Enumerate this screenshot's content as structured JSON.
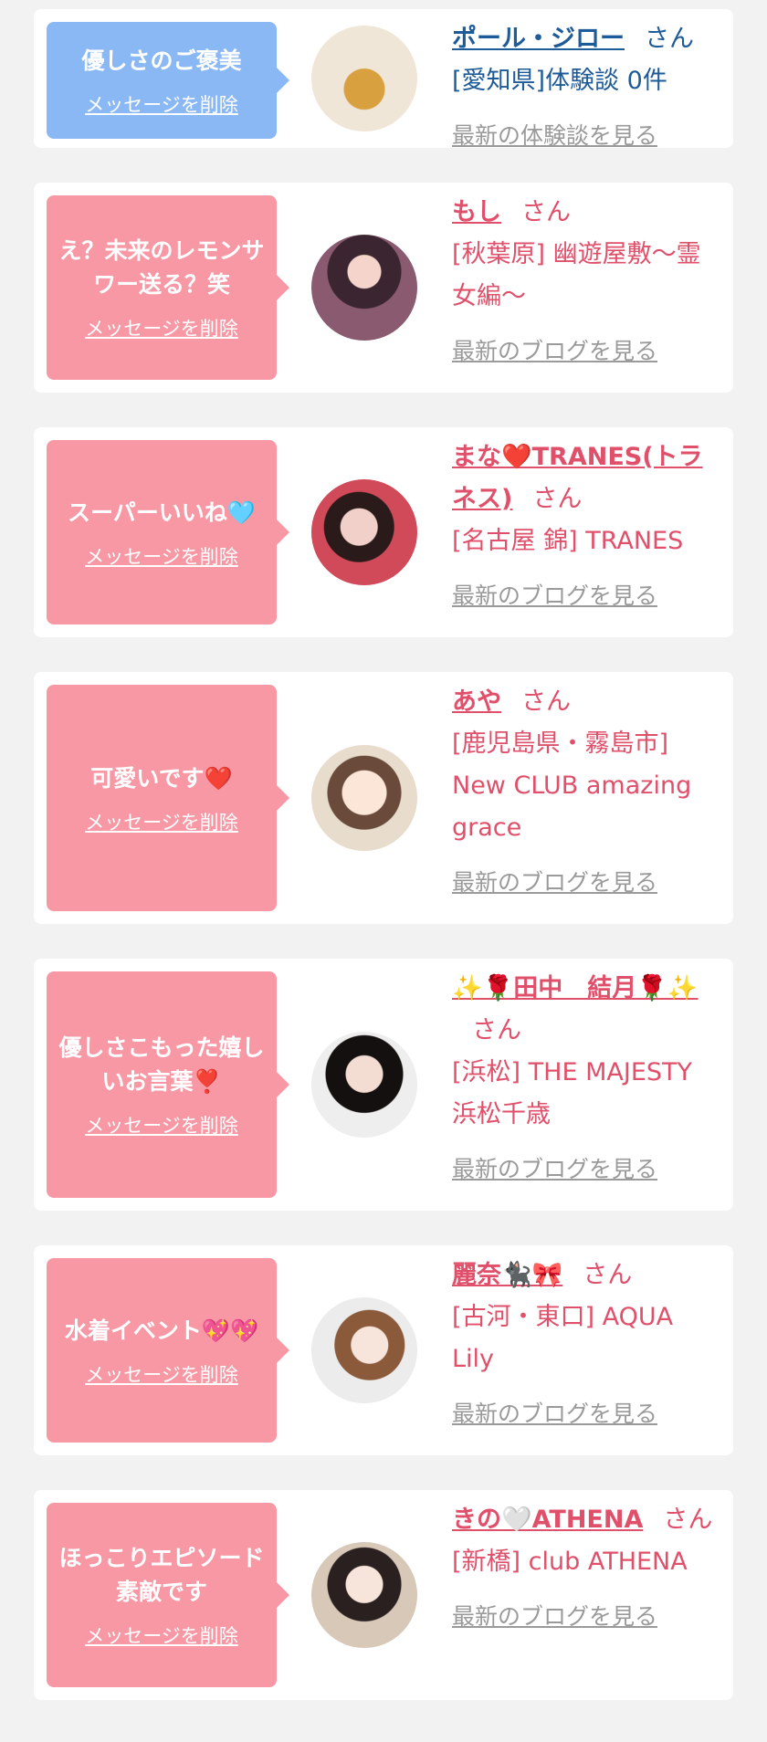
{
  "cards": [
    {
      "message": "優しさのご褒美",
      "delete_label": "メッセージを削除",
      "name": "ポール・ジロー",
      "honorific": "さん",
      "detail": "[愛知県]体験談 0件",
      "latest_label": "最新の体験談を見る",
      "avatar": "bottle-avatar",
      "color": "#8ab8f5"
    },
    {
      "message": "え？未来のレモンサワー送る？笑",
      "delete_label": "メッセージを削除",
      "name": "もし",
      "honorific": "さん",
      "detail": "[秋葉原] 幽遊屋敷〜霊女編〜",
      "latest_label": "最新のブログを見る",
      "avatar": "girl-avatar",
      "color": "#f898a4"
    },
    {
      "message": "スーパーいいね🩵",
      "delete_label": "メッセージを削除",
      "name": "まな❤️TRANES(トラネス)",
      "honorific": "さん",
      "detail": "[名古屋 錦] TRANES",
      "latest_label": "最新のブログを見る",
      "avatar": "girl-avatar",
      "color": "#f898a4"
    },
    {
      "message": "可愛いです❤️",
      "delete_label": "メッセージを削除",
      "name": "あや",
      "honorific": "さん",
      "detail": "[鹿児島県・霧島市] New CLUB amazing grace",
      "latest_label": "最新のブログを見る",
      "avatar": "illustration-avatar",
      "color": "#f898a4"
    },
    {
      "message": "優しさこもった嬉しいお言葉❣️",
      "delete_label": "メッセージを削除",
      "name": "✨🌹田中　結月🌹✨",
      "honorific": "さん",
      "detail": "[浜松] THE MAJESTY 浜松千歳",
      "latest_label": "最新のブログを見る",
      "avatar": "girl-avatar",
      "color": "#f898a4"
    },
    {
      "message": "水着イベント💖💖",
      "delete_label": "メッセージを削除",
      "name": "麗奈🐈‍⬛🎀",
      "honorific": "さん",
      "detail": "[古河・東口] AQUA Lily",
      "latest_label": "最新のブログを見る",
      "avatar": "girl-avatar",
      "color": "#f898a4"
    },
    {
      "message": "ほっこりエピソード素敵です",
      "delete_label": "メッセージを削除",
      "name": "きの🤍ATHENA",
      "honorific": "さん",
      "detail": "[新橋] club ATHENA",
      "latest_label": "最新のブログを見る",
      "avatar": "girl-avatar",
      "color": "#f898a4"
    }
  ]
}
